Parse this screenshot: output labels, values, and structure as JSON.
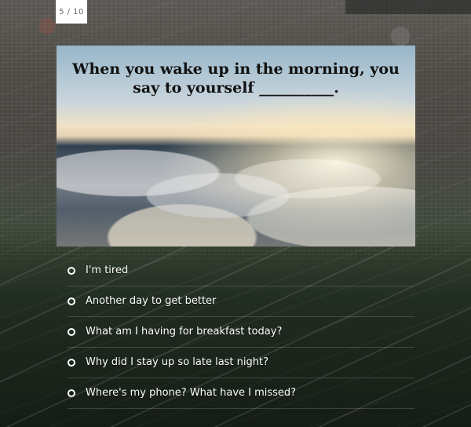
{
  "quiz": {
    "counter_text": "5 / 10",
    "question": "When you wake up in the morning, you say to yourself __________.",
    "options": [
      "I'm tired",
      "Another day to get better",
      "What am I having for breakfast today?",
      "Why did I stay up so late last night?",
      "Where's my phone? What have I missed?"
    ]
  }
}
